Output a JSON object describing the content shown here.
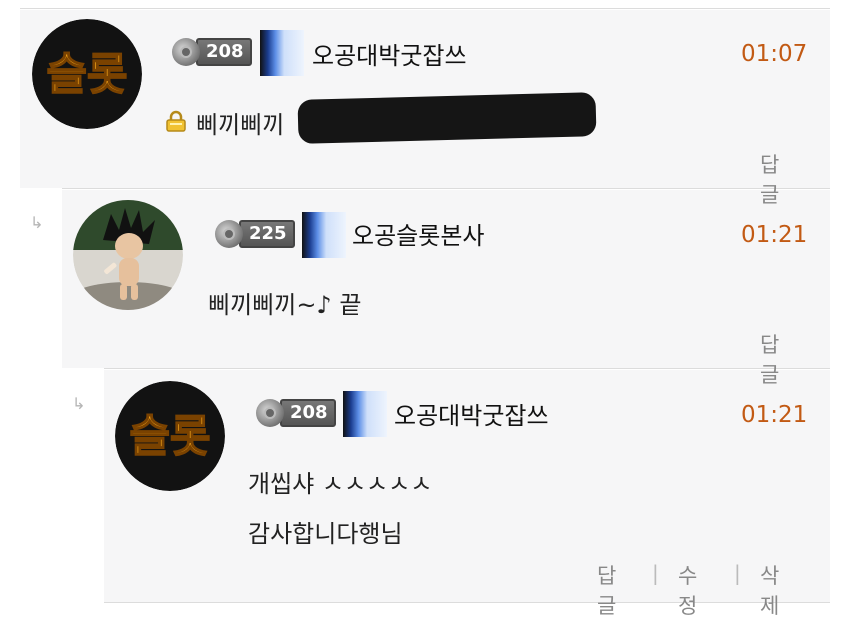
{
  "comments": [
    {
      "level": "208",
      "nickname": "오공대박굿잡쓰",
      "time": "01:07",
      "text": "삐끼삐끼",
      "actions": [
        "답글"
      ]
    },
    {
      "level": "225",
      "nickname": "오공슬롯본사",
      "time": "01:21",
      "text": "삐끼삐끼~♪ 끝",
      "actions": [
        "답글"
      ]
    },
    {
      "level": "208",
      "nickname": "오공대박굿잡쓰",
      "time": "01:21",
      "lines": [
        "개씹샤 ㅅㅅㅅㅅㅅ",
        "감사합니다행님"
      ],
      "actions": [
        "답글",
        "수정",
        "삭제"
      ]
    }
  ],
  "avatar_text": "슬롯",
  "reply_arrow": "↳",
  "colors": {
    "time": "#c25a14",
    "row_bg": "#f6f6f7",
    "separator": "#dcdcdc",
    "action": "#888888"
  },
  "icons": [
    "lock-icon",
    "level-badge-icon",
    "grade-icon",
    "reply-arrow-icon"
  ]
}
